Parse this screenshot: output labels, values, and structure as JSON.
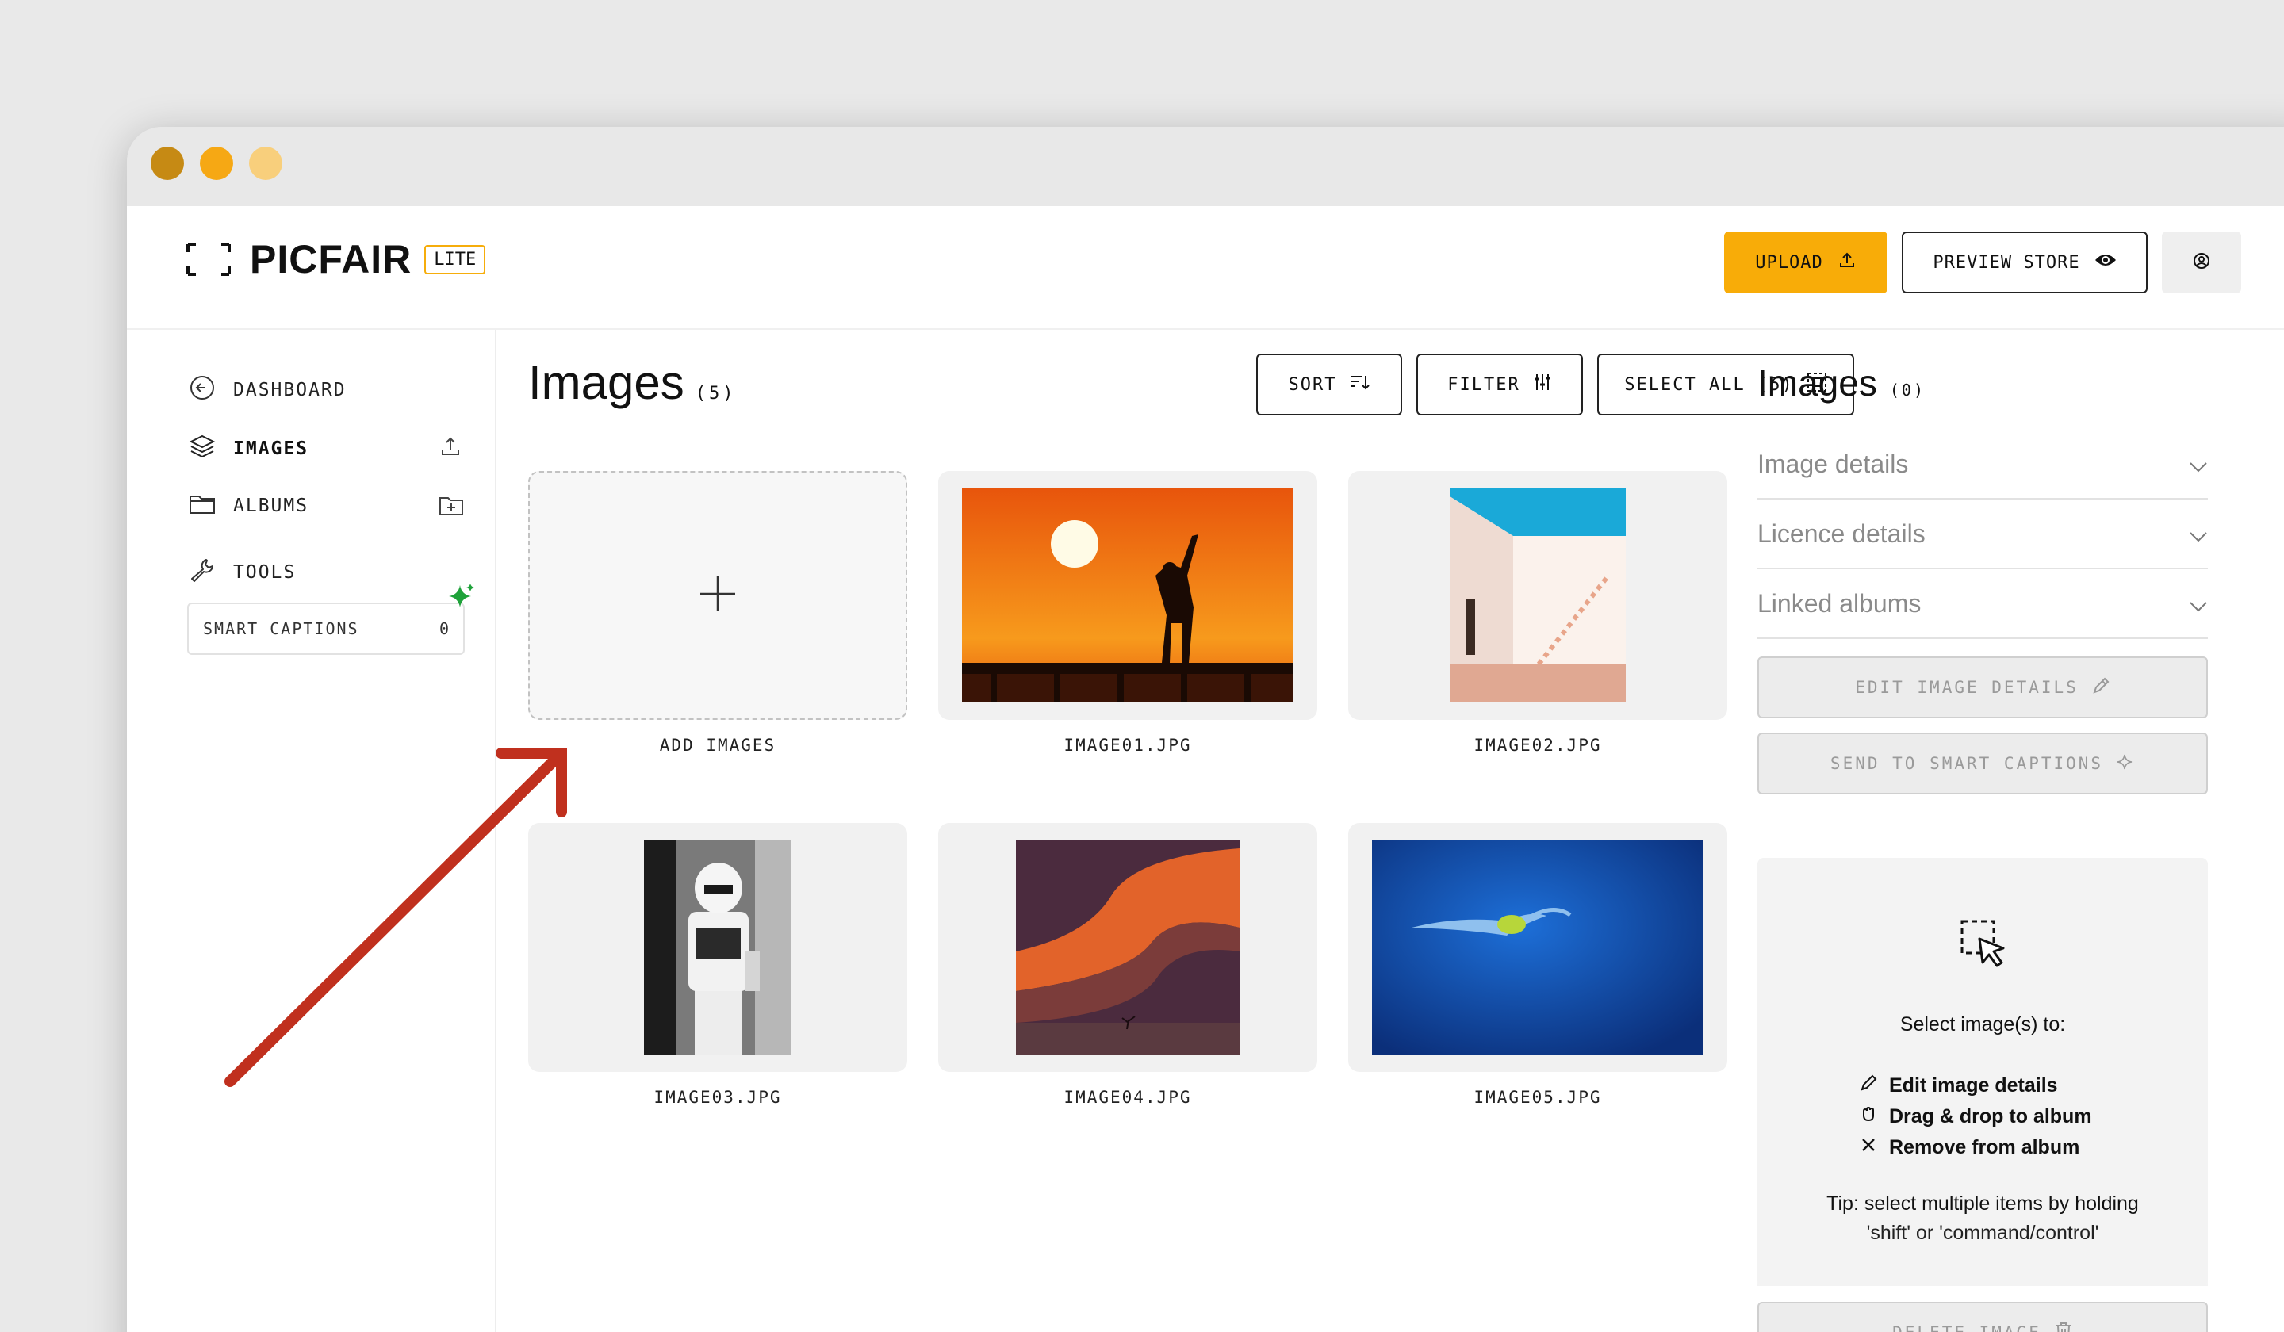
{
  "app": {
    "brand": "PICFAIR",
    "badge": "LITE",
    "upload_label": "UPLOAD",
    "preview_label": "PREVIEW STORE",
    "colors": {
      "accent": "#f8ac08",
      "dot1": "#c68a14",
      "dot2": "#f6a814",
      "dot3": "#f8cf7c",
      "arrow": "#c0301e",
      "sparkle": "#1fa23a"
    }
  },
  "sidebar": {
    "items": [
      {
        "label": "DASHBOARD",
        "icon": "arrow-left-circle-icon"
      },
      {
        "label": "IMAGES",
        "icon": "layers-icon",
        "action_icon": "upload-icon"
      },
      {
        "label": "ALBUMS",
        "icon": "folder-icon",
        "action_icon": "folder-plus-icon"
      },
      {
        "label": "TOOLS",
        "icon": "wrench-icon"
      }
    ],
    "smart_captions": {
      "label": "SMART CAPTIONS",
      "count": "0"
    }
  },
  "main": {
    "title": "Images",
    "count": "(5)",
    "sort_label": "SORT",
    "filter_label": "FILTER",
    "select_all_label": "SELECT ALL (5)",
    "add_label": "ADD IMAGES",
    "images": [
      {
        "name": "IMAGE01.JPG"
      },
      {
        "name": "IMAGE02.JPG"
      },
      {
        "name": "IMAGE03.JPG"
      },
      {
        "name": "IMAGE04.JPG"
      },
      {
        "name": "IMAGE05.JPG"
      }
    ]
  },
  "panel": {
    "title": "Images",
    "count": "(0)",
    "accordions": [
      "Image details",
      "Licence details",
      "Linked albums"
    ],
    "edit_label": "EDIT IMAGE DETAILS",
    "send_label": "SEND TO SMART CAPTIONS",
    "hint_lead": "Select image(s) to:",
    "hint_items": [
      "Edit image details",
      "Drag & drop to album",
      "Remove from album"
    ],
    "tip_line1": "Tip: select multiple items by holding",
    "tip_line2": "'shift' or 'command/control'",
    "delete_label": "DELETE IMAGE"
  }
}
